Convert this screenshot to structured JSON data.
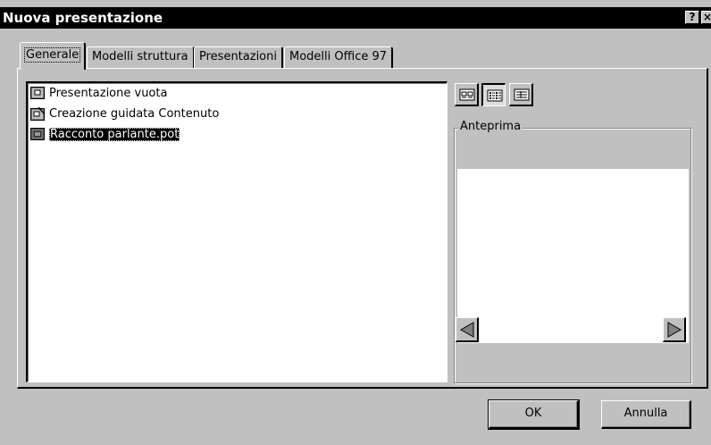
{
  "window": {
    "title": "Nuova presentazione",
    "help_button": "?",
    "close_button": "×"
  },
  "tabs": [
    {
      "label": "Generale",
      "active": true
    },
    {
      "label": "Modelli struttura",
      "active": false
    },
    {
      "label": "Presentazioni",
      "active": false
    },
    {
      "label": "Modelli Office 97",
      "active": false
    }
  ],
  "list": {
    "items": [
      {
        "label": "Presentazione vuota",
        "icon": "blank-presentation-icon",
        "selected": false
      },
      {
        "label": "Creazione guidata Contenuto",
        "icon": "content-wizard-icon",
        "selected": false
      },
      {
        "label": "Racconto parlante.pot",
        "icon": "template-icon",
        "selected": true
      }
    ]
  },
  "view_buttons": [
    {
      "icon": "large-icons-view-icon",
      "pressed": false
    },
    {
      "icon": "list-view-icon",
      "pressed": true
    },
    {
      "icon": "details-view-icon",
      "pressed": false
    }
  ],
  "preview": {
    "label": "Anteprima"
  },
  "buttons": {
    "ok": "OK",
    "cancel": "Annulla"
  },
  "colors": {
    "dialog_bg": "#c0c0c0",
    "titlebar": "#000000",
    "selection": "#000000"
  }
}
